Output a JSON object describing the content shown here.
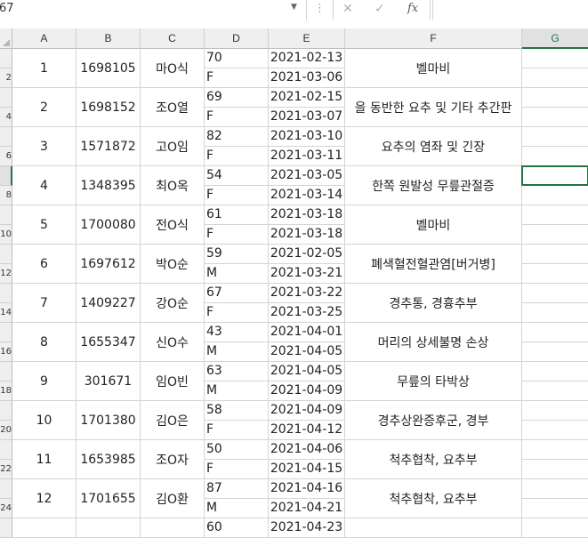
{
  "formula_bar": {
    "name_box": "67",
    "cancel_icon": "✕",
    "enter_icon": "✓",
    "fx_label": "fx",
    "content": ""
  },
  "columns": [
    "A",
    "B",
    "C",
    "D",
    "E",
    "F",
    "G"
  ],
  "row_numbers": [
    "",
    "2",
    "",
    "4",
    "",
    "6",
    "",
    "8",
    "",
    "10",
    "",
    "12",
    "",
    "14",
    "",
    "16",
    "",
    "18",
    "",
    "20",
    "",
    "22",
    "",
    "24",
    "",
    "26"
  ],
  "records": [
    {
      "a": "1",
      "b": "1698105",
      "c": "마O식",
      "d1": "70",
      "d2": "F",
      "e1": "2021-02-13",
      "e2": "2021-03-06",
      "f": "벨마비"
    },
    {
      "a": "2",
      "b": "1698152",
      "c": "조O열",
      "d1": "69",
      "d2": "F",
      "e1": "2021-02-15",
      "e2": "2021-03-07",
      "f": "을 동반한 요추 및 기타 추간판"
    },
    {
      "a": "3",
      "b": "1571872",
      "c": "고O임",
      "d1": "82",
      "d2": "F",
      "e1": "2021-03-10",
      "e2": "2021-03-11",
      "f": "요추의 염좌 및 긴장"
    },
    {
      "a": "4",
      "b": "1348395",
      "c": "최O옥",
      "d1": "54",
      "d2": "F",
      "e1": "2021-03-05",
      "e2": "2021-03-14",
      "f": "한쪽 원발성 무릎관절증"
    },
    {
      "a": "5",
      "b": "1700080",
      "c": "전O식",
      "d1": "61",
      "d2": "F",
      "e1": "2021-03-18",
      "e2": "2021-03-18",
      "f": "벨마비"
    },
    {
      "a": "6",
      "b": "1697612",
      "c": "박O순",
      "d1": "59",
      "d2": "M",
      "e1": "2021-02-05",
      "e2": "2021-03-21",
      "f": "폐색혈전혈관염[버거병]"
    },
    {
      "a": "7",
      "b": "1409227",
      "c": "강O순",
      "d1": "67",
      "d2": "F",
      "e1": "2021-03-22",
      "e2": "2021-03-25",
      "f": "경추통, 경흉추부"
    },
    {
      "a": "8",
      "b": "1655347",
      "c": "신O수",
      "d1": "43",
      "d2": "M",
      "e1": "2021-04-01",
      "e2": "2021-04-05",
      "f": "머리의 상세불명 손상"
    },
    {
      "a": "9",
      "b": "301671",
      "c": "임O빈",
      "d1": "63",
      "d2": "M",
      "e1": "2021-04-05",
      "e2": "2021-04-09",
      "f": "무릎의 타박상"
    },
    {
      "a": "10",
      "b": "1701380",
      "c": "김O은",
      "d1": "58",
      "d2": "F",
      "e1": "2021-04-09",
      "e2": "2021-04-12",
      "f": "경추상완증후군, 경부"
    },
    {
      "a": "11",
      "b": "1653985",
      "c": "조O자",
      "d1": "50",
      "d2": "F",
      "e1": "2021-04-06",
      "e2": "2021-04-15",
      "f": "척추협착, 요추부"
    },
    {
      "a": "12",
      "b": "1701655",
      "c": "김O환",
      "d1": "87",
      "d2": "M",
      "e1": "2021-04-16",
      "e2": "2021-04-21",
      "f": "척추협착, 요추부"
    }
  ],
  "partial_row": {
    "d1": "60",
    "e1": "2021-04-23"
  },
  "colors": {
    "accent": "#217346",
    "grid": "#d4d4d4",
    "header_bg": "#efefef"
  }
}
